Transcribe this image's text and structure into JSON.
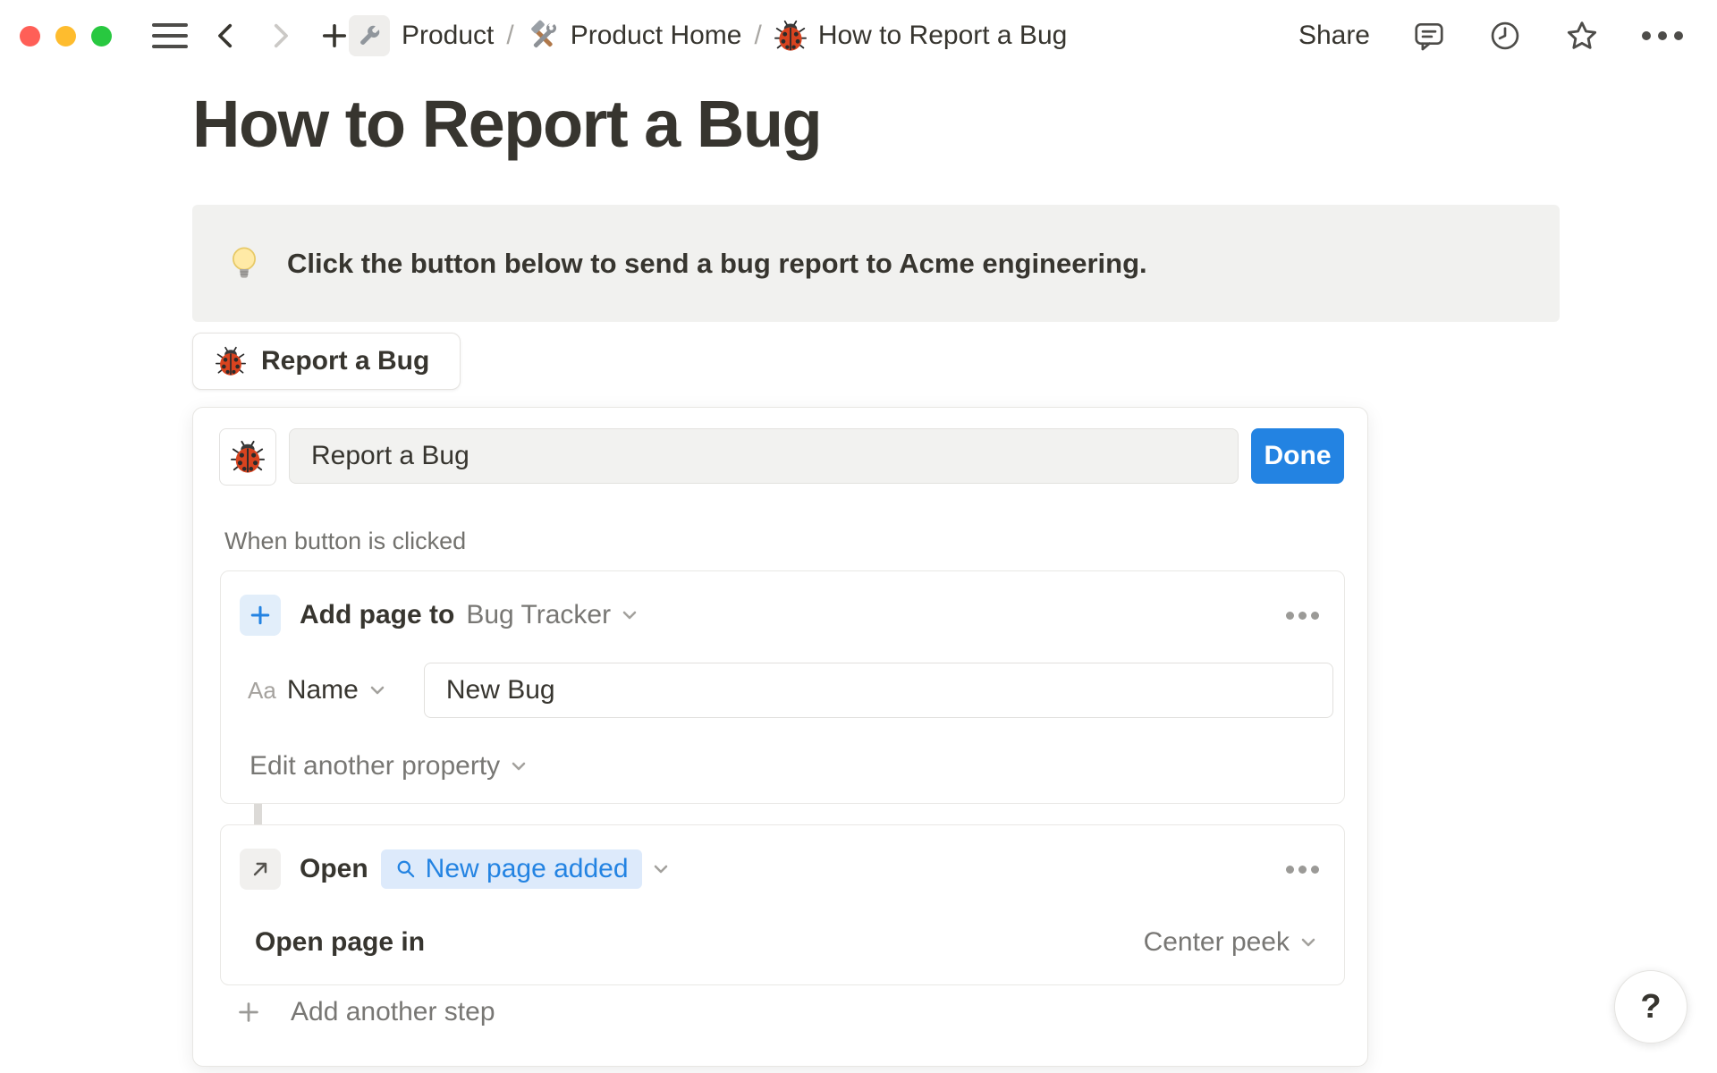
{
  "topbar": {
    "breadcrumbs": [
      {
        "icon": "wrench-icon",
        "label": "Product"
      },
      {
        "icon": "hammer-and-wrench-icon",
        "label": "Product Home"
      },
      {
        "icon": "ladybug-icon",
        "label": "How to Report a Bug"
      }
    ],
    "separator": "/",
    "share_label": "Share",
    "right_icons": [
      "comment-icon",
      "clock-icon",
      "star-icon",
      "ellipsis-icon"
    ]
  },
  "page": {
    "title": "How to Report a Bug",
    "callout": {
      "icon": "light-bulb-icon",
      "text": "Click the button below to send a bug report to Acme engineering."
    },
    "report_button": {
      "icon": "ladybug-icon",
      "label": "Report a Bug"
    }
  },
  "editor": {
    "icon": "ladybug-icon",
    "button_name_value": "Report a Bug",
    "done_label": "Done",
    "trigger_label": "When button is clicked",
    "step1": {
      "icon": "plus-icon",
      "action": "Add page to",
      "target": "Bug Tracker",
      "property_type": "Aa",
      "property_name": "Name",
      "property_value": "New Bug",
      "edit_another": "Edit another property"
    },
    "step2": {
      "icon": "arrow-up-right-icon",
      "action": "Open",
      "target_pill": "New page added",
      "pill_icon": "search-icon",
      "open_page_in": "Open page in",
      "mode": "Center peek"
    },
    "add_step": "Add another step"
  },
  "help_label": "?",
  "colors": {
    "accent_blue": "#2383e2",
    "pill_bg": "#ddeafb",
    "callout_bg": "#f1f1ef",
    "text_dark": "#37352f",
    "text_gray": "#787774",
    "traffic_red": "#ff5f57",
    "traffic_yellow": "#febc2e",
    "traffic_green": "#28c840"
  }
}
